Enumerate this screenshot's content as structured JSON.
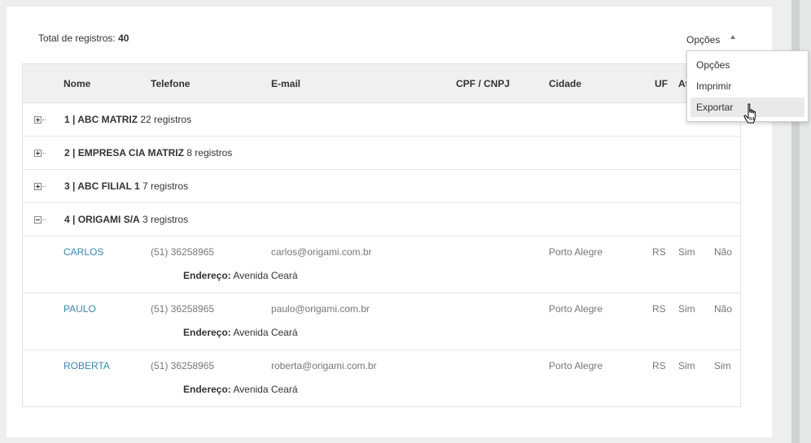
{
  "header": {
    "total_label": "Total de registros:",
    "total_value": "40",
    "options_label": "Opções"
  },
  "dropdown": {
    "items": [
      {
        "label": "Opções"
      },
      {
        "label": "Imprimir"
      },
      {
        "label": "Exportar"
      }
    ],
    "hovered": "Exportar"
  },
  "table": {
    "columns": [
      "Nome",
      "Telefone",
      "E-mail",
      "CPF / CNPJ",
      "Cidade",
      "UF",
      "At"
    ],
    "groups": [
      {
        "title": "1 | ABC MATRIZ",
        "count": "22 registros",
        "expanded": false
      },
      {
        "title": "2 | EMPRESA CIA MATRIZ",
        "count": "8 registros",
        "expanded": false
      },
      {
        "title": "3 | ABC FILIAL 1",
        "count": "7 registros",
        "expanded": false
      },
      {
        "title": "4 | ORIGAMI S/A",
        "count": "3 registros",
        "expanded": true
      }
    ],
    "rows": [
      {
        "nome": "CARLOS",
        "telefone": "(51) 36258965",
        "email": "carlos@origami.com.br",
        "cidade": "Porto Alegre",
        "uf": "RS",
        "col7": "Sim",
        "col8": "Não",
        "endereco_label": "Endereço:",
        "endereco": "Avenida Ceará"
      },
      {
        "nome": "PAULO",
        "telefone": "(51) 36258965",
        "email": "paulo@origami.com.br",
        "cidade": "Porto Alegre",
        "uf": "RS",
        "col7": "Sim",
        "col8": "Não",
        "endereco_label": "Endereço:",
        "endereco": "Avenida Ceará"
      },
      {
        "nome": "ROBERTA",
        "telefone": "(51) 36258965",
        "email": "roberta@origami.com.br",
        "cidade": "Porto Alegre",
        "uf": "RS",
        "col7": "Sim",
        "col8": "Sim",
        "endereco_label": "Endereço:",
        "endereco": "Avenida Ceará"
      }
    ]
  },
  "icons": {
    "expand": "plus-square-icon",
    "collapse": "minus-square-icon",
    "caret": "caret-up-icon",
    "cursor": "hand-pointer-icon"
  },
  "colors": {
    "link": "#3a87ad",
    "header_bg": "#f0f0f0",
    "hover_bg": "#e9e9e9"
  }
}
